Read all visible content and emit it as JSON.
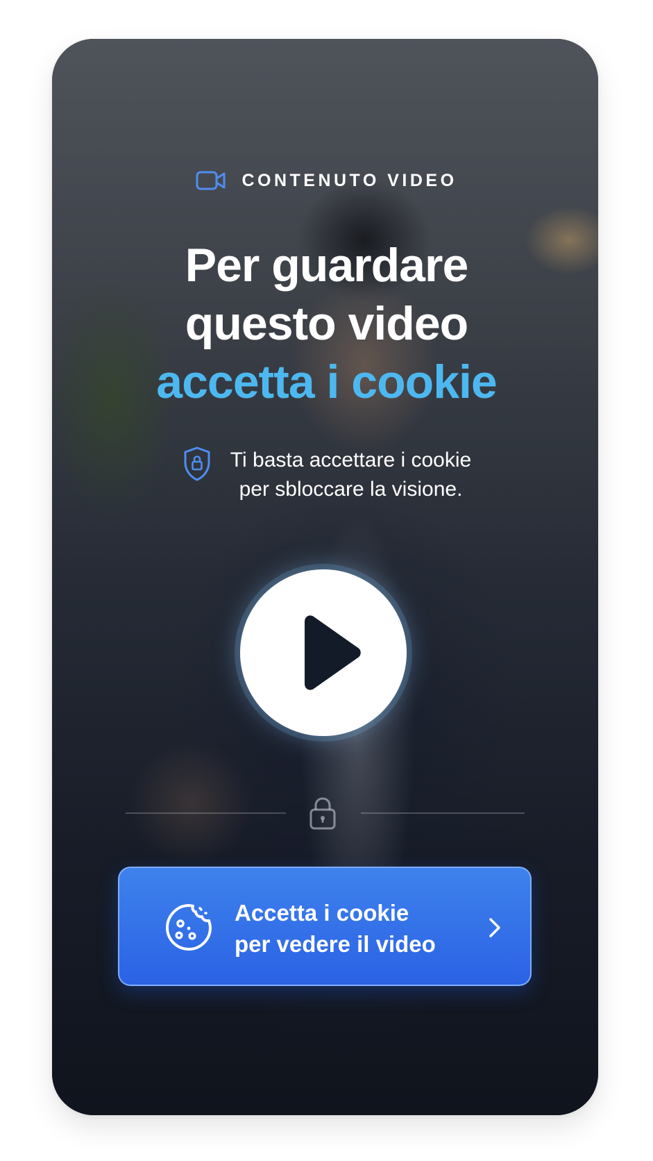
{
  "eyebrow": {
    "icon": "video-camera-icon",
    "label": "CONTENUTO VIDEO"
  },
  "headline": {
    "line1": "Per guardare",
    "line2": "questo video",
    "accent": "accetta i cookie",
    "accent_color": "#4db8f0"
  },
  "note": {
    "icon": "shield-lock-icon",
    "line1": "Ti basta accettare i cookie",
    "line2": "per sbloccare la visione."
  },
  "player": {
    "play_icon": "play-icon",
    "lock_icon": "lock-icon"
  },
  "cta": {
    "icon": "cookie-icon",
    "line1": "Accetta i cookie",
    "line2": "per vedere il video",
    "chevron": "chevron-right-icon",
    "color": "#2f6ae6"
  }
}
